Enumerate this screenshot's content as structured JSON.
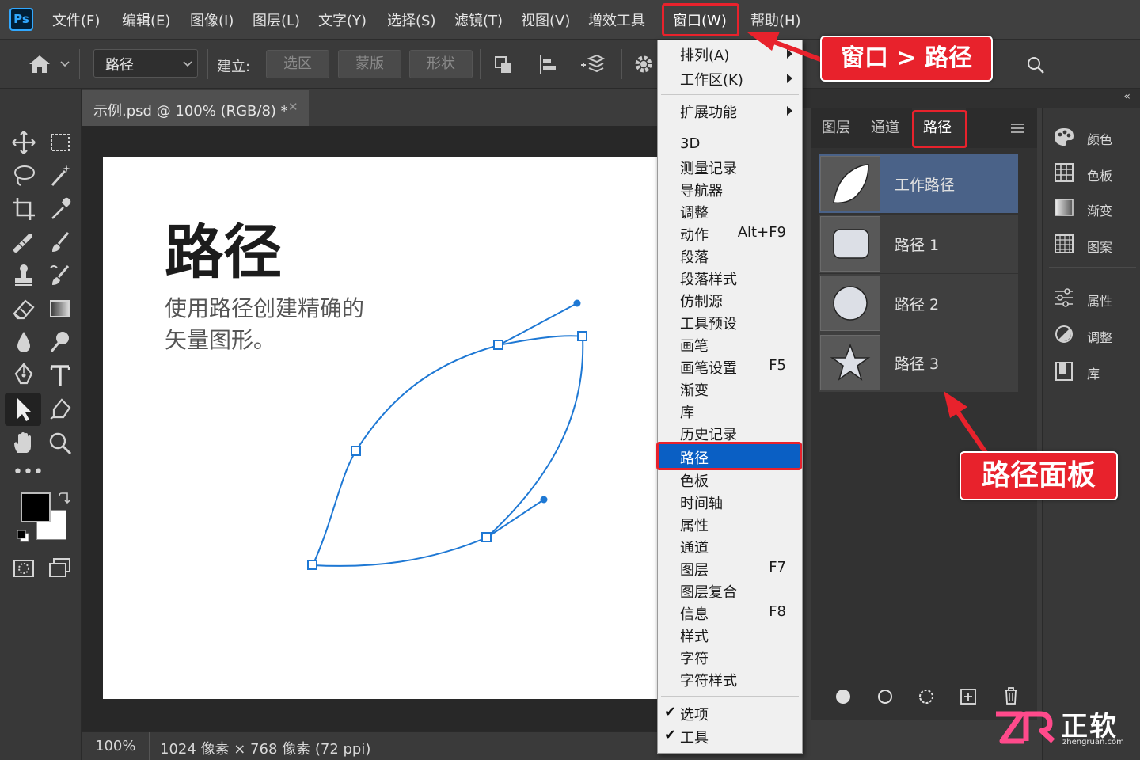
{
  "app": {
    "logo": "Ps"
  },
  "menubar": [
    "文件(F)",
    "编辑(E)",
    "图像(I)",
    "图层(L)",
    "文字(Y)",
    "选择(S)",
    "滤镜(T)",
    "视图(V)",
    "增效工具",
    "窗口(W)",
    "帮助(H)"
  ],
  "optbar": {
    "tool_select": "路径",
    "make_label": "建立:",
    "make_selection": "选区",
    "make_mask": "蒙版",
    "make_shape": "形状"
  },
  "document": {
    "tab_title": "示例.psd @ 100% (RGB/8) *",
    "heading": "路径",
    "body_line1": "使用路径创建精确的",
    "body_line2": "矢量图形。"
  },
  "status": {
    "zoom": "100%",
    "info": "1024 像素 × 768 像素 (72 ppi)"
  },
  "window_menu": {
    "items": [
      {
        "label": "排列(A)",
        "submenu": true
      },
      {
        "label": "工作区(K)",
        "submenu": true
      },
      {
        "label": "扩展功能",
        "submenu": true
      },
      {
        "label": "3D"
      },
      {
        "label": "测量记录"
      },
      {
        "label": "导航器"
      },
      {
        "label": "调整"
      },
      {
        "label": "动作",
        "shortcut": "Alt+F9"
      },
      {
        "label": "段落"
      },
      {
        "label": "段落样式"
      },
      {
        "label": "仿制源"
      },
      {
        "label": "工具预设"
      },
      {
        "label": "画笔"
      },
      {
        "label": "画笔设置",
        "shortcut": "F5"
      },
      {
        "label": "渐变"
      },
      {
        "label": "库"
      },
      {
        "label": "历史记录"
      },
      {
        "label": "路径",
        "highlighted": true
      },
      {
        "label": "色板"
      },
      {
        "label": "时间轴"
      },
      {
        "label": "属性"
      },
      {
        "label": "通道"
      },
      {
        "label": "图层",
        "shortcut": "F7"
      },
      {
        "label": "图层复合"
      },
      {
        "label": "信息",
        "shortcut": "F8"
      },
      {
        "label": "样式"
      },
      {
        "label": "字符"
      },
      {
        "label": "字符样式"
      },
      {
        "label": "选项",
        "checked": true
      },
      {
        "label": "工具",
        "checked": true
      }
    ]
  },
  "panel": {
    "tabs": [
      "图层",
      "通道",
      "路径"
    ],
    "active_tab": "路径",
    "paths": [
      {
        "name": "工作路径",
        "thumb": "leaf-icon",
        "selected": true
      },
      {
        "name": "路径 1",
        "thumb": "rounded-rect-icon"
      },
      {
        "name": "路径 2",
        "thumb": "circle-icon"
      },
      {
        "name": "路径 3",
        "thumb": "star-icon"
      }
    ]
  },
  "dock": [
    "颜色",
    "色板",
    "渐变",
    "图案",
    "属性",
    "调整",
    "库"
  ],
  "callouts": {
    "menu_path": "窗口 > 路径",
    "panel": "路径面板"
  },
  "watermark": {
    "text": "正软",
    "url": "zhengruan.com"
  },
  "colors": {
    "accent": "#e8222c",
    "highlight": "#0a5fc4",
    "path_stroke": "#1e78d4",
    "selected_row": "#4a6288"
  }
}
